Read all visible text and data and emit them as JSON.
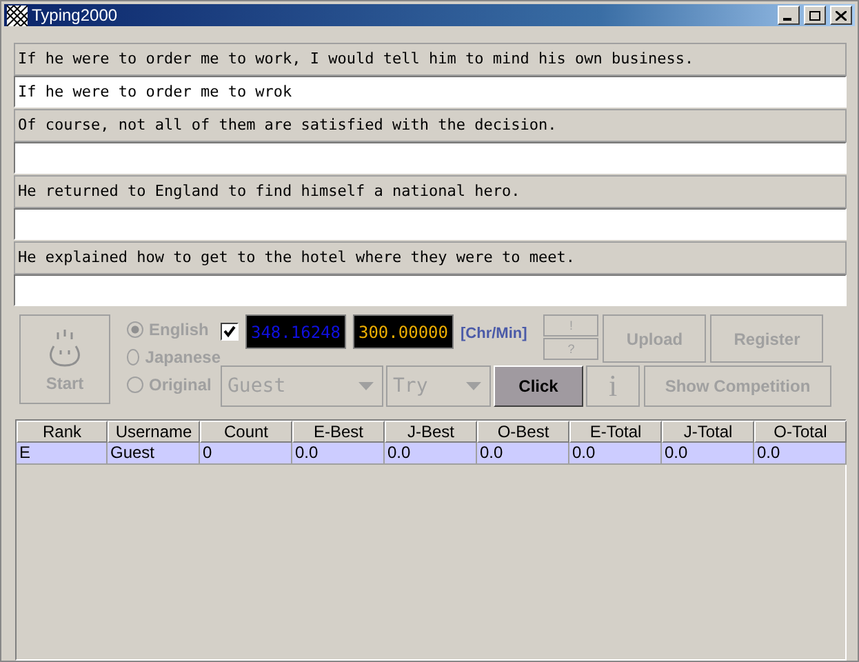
{
  "window": {
    "title": "Typing2000"
  },
  "sentences": [
    {
      "prompt": "If he were to order me to work, I would tell him to mind his own business.",
      "typed": "If he were to order me to wrok"
    },
    {
      "prompt": "Of course, not all of them are satisfied with the decision."
    },
    {
      "prompt": "He returned to England to find himself a national hero."
    },
    {
      "prompt": "He explained how to get to the hotel where they were to meet."
    }
  ],
  "start_button": {
    "label": "Start",
    "disabled": true
  },
  "languages": [
    {
      "label": "English",
      "selected": true,
      "disabled": true
    },
    {
      "label": "Japanese",
      "selected": false,
      "disabled": true
    },
    {
      "label": "Original",
      "selected": false,
      "disabled": true
    }
  ],
  "speed": {
    "checked": true,
    "current": "348.16248",
    "target": "300.00000",
    "unit": "[Chr/Min]"
  },
  "small_buttons": [
    {
      "label": "!",
      "disabled": true
    },
    {
      "label": "?",
      "disabled": true
    }
  ],
  "user_select": {
    "value": "Guest",
    "disabled": true
  },
  "mode_select": {
    "value": "Try",
    "disabled": true
  },
  "buttons_row1": [
    {
      "label": "Upload",
      "disabled": true
    },
    {
      "label": "Register",
      "disabled": true
    }
  ],
  "click_button": {
    "label": "Click",
    "disabled": false
  },
  "info_button": {
    "label": "i",
    "disabled": true
  },
  "competition_button": {
    "label": "Show Competition",
    "disabled": true
  },
  "table": {
    "columns": [
      "Rank",
      "Username",
      "Count",
      "E-Best",
      "J-Best",
      "O-Best",
      "E-Total",
      "J-Total",
      "O-Total"
    ],
    "rows": [
      {
        "selected": true,
        "cells": [
          "E",
          "Guest",
          "0",
          "0.0",
          "0.0",
          "0.0",
          "0.0",
          "0.0",
          "0.0"
        ]
      }
    ]
  }
}
